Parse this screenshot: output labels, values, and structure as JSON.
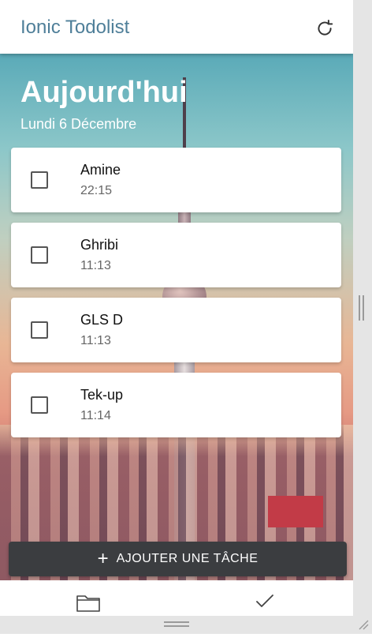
{
  "header": {
    "title": "Ionic Todolist",
    "refresh_icon": "refresh-icon"
  },
  "hero": {
    "title": "Aujourd'hui",
    "subtitle": "Lundi 6 Décembre"
  },
  "tasks": [
    {
      "name": "Amine",
      "time": "22:15",
      "checked": false
    },
    {
      "name": "Ghribi",
      "time": "11:13",
      "checked": false
    },
    {
      "name": "GLS D",
      "time": "11:13",
      "checked": false
    },
    {
      "name": "Tek-up",
      "time": "11:14",
      "checked": false
    }
  ],
  "add_button": {
    "icon": "+",
    "label": "AJOUTER UNE TÂCHE"
  },
  "tabs": {
    "left_icon": "folder-icon",
    "right_icon": "checkmark-icon"
  },
  "colors": {
    "title": "#4f7f99",
    "button": "#3b3d40"
  }
}
